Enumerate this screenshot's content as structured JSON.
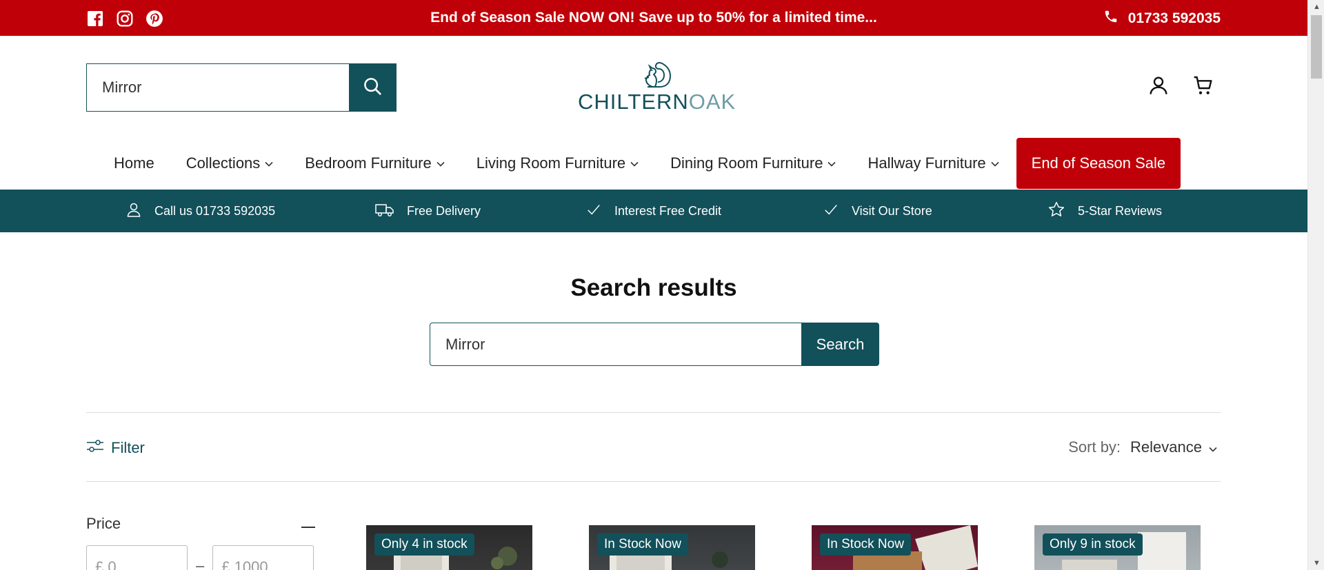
{
  "announcement": {
    "text": "End of Season Sale NOW ON! Save up to 50% for a limited time...",
    "phone": "01733 592035",
    "social_icons": [
      "facebook-icon",
      "instagram-icon",
      "pinterest-icon"
    ]
  },
  "header": {
    "search_value": "Mirror",
    "logo_main": "CHILTERN",
    "logo_accent": "OAK"
  },
  "nav": {
    "items": [
      {
        "label": "Home",
        "has_dropdown": false
      },
      {
        "label": "Collections",
        "has_dropdown": true
      },
      {
        "label": "Bedroom Furniture",
        "has_dropdown": true
      },
      {
        "label": "Living Room Furniture",
        "has_dropdown": true
      },
      {
        "label": "Dining Room Furniture",
        "has_dropdown": true
      },
      {
        "label": "Hallway Furniture",
        "has_dropdown": true
      }
    ],
    "sale_label": "End of Season Sale"
  },
  "usp": [
    {
      "icon": "person-icon",
      "label": "Call us 01733 592035"
    },
    {
      "icon": "truck-icon",
      "label": "Free Delivery"
    },
    {
      "icon": "check-icon",
      "label": "Interest Free Credit"
    },
    {
      "icon": "check-icon",
      "label": "Visit Our Store"
    },
    {
      "icon": "star-icon",
      "label": "5-Star Reviews"
    }
  ],
  "main": {
    "title": "Search results",
    "search_value": "Mirror",
    "search_button": "Search",
    "filter_label": "Filter",
    "sort_label": "Sort by:",
    "sort_value": "Relevance"
  },
  "price_filter": {
    "label": "Price",
    "min_placeholder": "0",
    "max_placeholder": "1000",
    "currency": "£",
    "separator": "–"
  },
  "products": [
    {
      "badge": "Only 4 in stock",
      "bg": "#2a2a2a"
    },
    {
      "badge": "In Stock Now",
      "bg": "#3a3d3e"
    },
    {
      "badge": "In Stock Now",
      "bg": "#6a1a32"
    },
    {
      "badge": "Only 9 in stock",
      "bg": "#9aa3a8"
    }
  ],
  "colors": {
    "brand_teal": "#12505a",
    "sale_red": "#c00008"
  }
}
